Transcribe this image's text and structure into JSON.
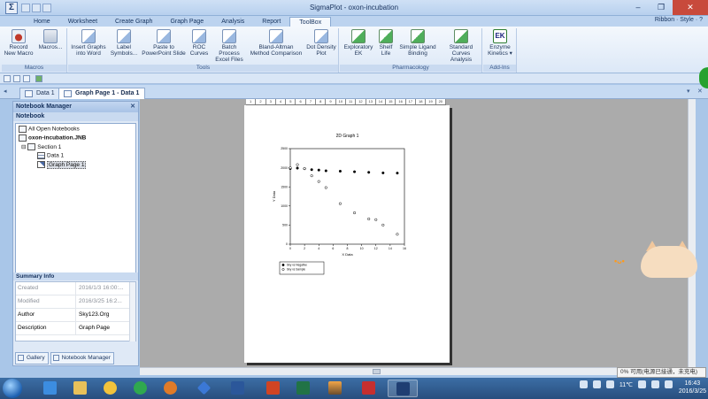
{
  "window": {
    "title": "SigmaPlot - oxon-incubation",
    "app_icon": "Σ",
    "controls": [
      "–",
      "❐",
      "✕"
    ]
  },
  "menu": {
    "tabs": [
      "Home",
      "Worksheet",
      "Create Graph",
      "Graph Page",
      "Analysis",
      "Report",
      "ToolBox"
    ],
    "active_tab": "ToolBox",
    "right": "Ribbon · Style · ?"
  },
  "ribbon": {
    "macros": {
      "label": "Macros",
      "record": "Record New Macro",
      "macros": "Macros..."
    },
    "tools": {
      "label": "Tools",
      "buttons": [
        "Insert Graphs into Word",
        "Label Symbols...",
        "Paste to PowerPoint Slide",
        "ROC Curves",
        "Batch Process Excel Files",
        "Bland-Altman Method Comparison",
        "Dot Density Plot"
      ]
    },
    "pharmacology": {
      "label": "Pharmacology",
      "buttons": [
        "Exploratory EK",
        "Shelf Life",
        "Simple Ligand Binding",
        "Standard Curves Analysis"
      ]
    },
    "addins": {
      "label": "Add-Ins",
      "button": "Enzyme Kinetics ▾",
      "icon_text": "EK"
    }
  },
  "doc_tabs": [
    {
      "label": "Data 1",
      "active": false
    },
    {
      "label": "Graph Page 1 - Data 1",
      "active": true
    }
  ],
  "notebook": {
    "title": "Notebook Manager",
    "section": "Notebook",
    "tree": {
      "root": "All Open Notebooks",
      "notebook": "oxon-incubation.JNB",
      "section": "Section 1",
      "items": [
        "Data 1",
        "Graph Page 1"
      ]
    },
    "summary_title": "Summary Info",
    "summary": [
      {
        "key": "Created",
        "value": "2016/1/3 16:00:..."
      },
      {
        "key": "Modified",
        "value": "2016/3/25 16:2..."
      },
      {
        "key": "Author",
        "value": "Sky123.Org"
      },
      {
        "key": "Description",
        "value": "Graph Page"
      }
    ],
    "bottom_tabs": [
      "Gallery",
      "Notebook Manager"
    ]
  },
  "ruler_marks": [
    "1",
    "2",
    "3",
    "4",
    "5",
    "6",
    "7",
    "8",
    "9",
    "10",
    "11",
    "12",
    "13",
    "14",
    "15",
    "16",
    "17",
    "18",
    "19",
    "20"
  ],
  "chart_data": {
    "type": "scatter",
    "title": "2D Graph 1",
    "xlabel": "X Data",
    "ylabel": "Y Data",
    "xlim": [
      0,
      16
    ],
    "ylim": [
      0,
      2500
    ],
    "xticks": [
      "0",
      "2",
      "4",
      "6",
      "8",
      "10",
      "12",
      "14",
      "16"
    ],
    "yticks": [
      "0",
      "500",
      "1000",
      "1500",
      "2000",
      "2500"
    ],
    "series": [
      {
        "name": "Sky vs Negative",
        "marker": "filled",
        "x": [
          0,
          1,
          2,
          3,
          4,
          5,
          7,
          9,
          11,
          13,
          15
        ],
        "y": [
          1980,
          1990,
          1975,
          1950,
          1940,
          1920,
          1910,
          1895,
          1880,
          1865,
          1860
        ]
      },
      {
        "name": "Sky vs Sample",
        "marker": "open",
        "x": [
          0,
          1,
          2,
          3,
          4,
          5,
          7,
          9,
          11,
          12,
          13,
          15
        ],
        "y": [
          2000,
          2080,
          1980,
          1790,
          1640,
          1480,
          1060,
          820,
          660,
          640,
          500,
          260
        ]
      }
    ]
  },
  "notify_text": "0% 可用(电源已接通，未充电)",
  "clock": {
    "time": "16:43",
    "date": "2016/3/25"
  },
  "tray": {
    "temp": "11℃"
  },
  "deco_text": "•ᴗ•"
}
